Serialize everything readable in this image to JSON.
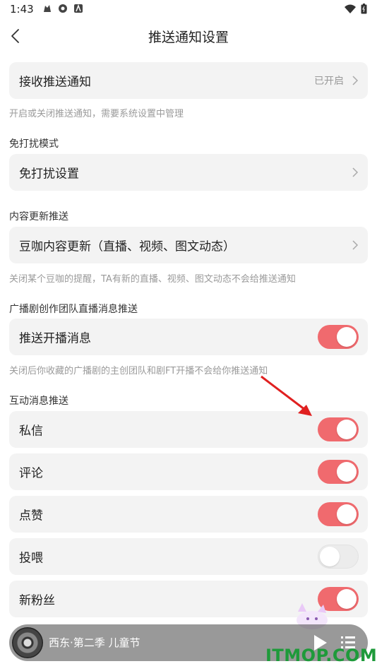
{
  "status_bar": {
    "time": "1:43"
  },
  "header": {
    "title": "推送通知设置"
  },
  "receive": {
    "label": "接收推送通知",
    "status": "已开启",
    "hint": "开启或关闭推送通知，需要系统设置中管理"
  },
  "dnd": {
    "section": "免打扰模式",
    "label": "免打扰设置"
  },
  "content": {
    "section": "内容更新推送",
    "label": "豆咖内容更新（直播、视频、图文动态）",
    "hint": "关闭某个豆咖的提醒，TA有新的直播、视频、图文动态不会给推送通知"
  },
  "drama": {
    "section": "广播剧创作团队直播消息推送",
    "label": "推送开播消息",
    "on": true,
    "hint": "关闭后你收藏的广播剧的主创团队和剧FT开播不会给你推送通知"
  },
  "interaction": {
    "section": "互动消息推送",
    "items": [
      {
        "label": "私信",
        "on": true
      },
      {
        "label": "评论",
        "on": true
      },
      {
        "label": "点赞",
        "on": true
      },
      {
        "label": "投喂",
        "on": false
      },
      {
        "label": "新粉丝",
        "on": true
      }
    ]
  },
  "player": {
    "song": "西东·第二季 儿童节"
  },
  "watermark": "ITMOP.COM",
  "colors": {
    "toggle_on": "#f06a6e",
    "card_bg": "#f3f3f3",
    "hint": "#9a9a9a"
  }
}
